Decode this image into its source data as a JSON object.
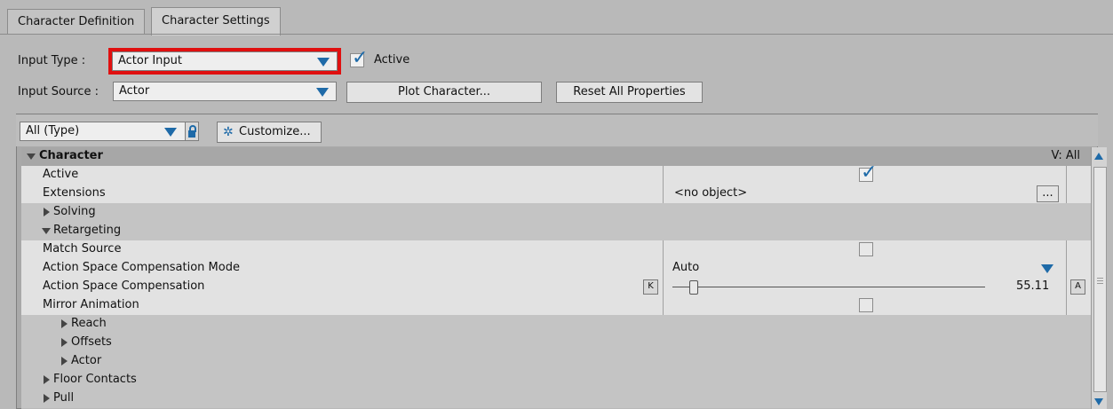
{
  "tabs": [
    {
      "label": "Character Definition",
      "active": false
    },
    {
      "label": "Character Settings",
      "active": true
    }
  ],
  "top": {
    "input_type_label": "Input Type :",
    "input_type_value": "Actor Input",
    "active_label": "Active",
    "active_checked": true,
    "input_source_label": "Input Source :",
    "input_source_value": "Actor",
    "plot_button": "Plot Character...",
    "reset_button": "Reset All Properties"
  },
  "toolbar": {
    "filter_value": "All (Type)",
    "customize_label": "Customize..."
  },
  "grid": {
    "category": "Character",
    "view_label": "V: All",
    "rows": [
      {
        "name": "Active",
        "value_checkbox": true
      },
      {
        "name": "Extensions",
        "value": "<no object>",
        "button": "..."
      },
      {
        "name": "Solving"
      },
      {
        "name": "Retargeting"
      },
      {
        "name": "Match Source",
        "value_checkbox": false
      },
      {
        "name": "Action Space Compensation Mode",
        "value": "Auto"
      },
      {
        "name": "Action Space Compensation",
        "key_label": "K",
        "value": "55.11",
        "anim_label": "A"
      },
      {
        "name": "Mirror Animation",
        "value_checkbox": false
      },
      {
        "name": "Reach"
      },
      {
        "name": "Offsets"
      },
      {
        "name": "Actor"
      },
      {
        "name": "Floor Contacts"
      },
      {
        "name": "Pull"
      }
    ]
  },
  "colors": {
    "accent": "#1e6aa8",
    "highlight": "#e01010"
  }
}
